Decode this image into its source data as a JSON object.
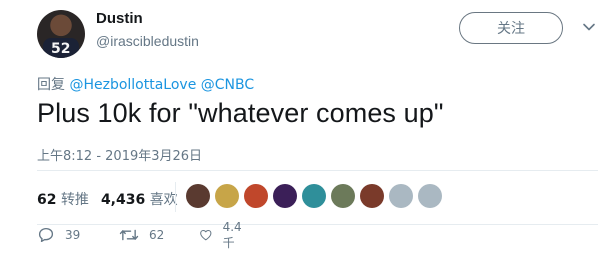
{
  "author": {
    "name": "Dustin",
    "handle": "@irascibledustin",
    "jersey_number": "52"
  },
  "follow_button": {
    "label": "关注"
  },
  "reply_to": {
    "prefix": "回复",
    "mentions": [
      "@HezbollottaLove",
      "@CNBC"
    ]
  },
  "tweet": {
    "text": "Plus 10k for \"whatever comes up\"",
    "timestamp": "上午8:12 - 2019年3月26日"
  },
  "stats": {
    "retweets_count": "62",
    "retweets_label": "转推",
    "likes_count": "4,436",
    "likes_label": "喜欢"
  },
  "liker_avatars": [
    {
      "name": "liker-avatar-1",
      "color": "#5a3a30"
    },
    {
      "name": "liker-avatar-2",
      "color": "#c7a548"
    },
    {
      "name": "liker-avatar-3",
      "color": "#c0472b"
    },
    {
      "name": "liker-avatar-4",
      "color": "#3b1f58"
    },
    {
      "name": "liker-avatar-5",
      "color": "#2f8f9a"
    },
    {
      "name": "liker-avatar-6",
      "color": "#6c7a5a"
    },
    {
      "name": "liker-avatar-7",
      "color": "#7a3a2a"
    },
    {
      "name": "liker-avatar-8",
      "color": "#aab8c2"
    },
    {
      "name": "liker-avatar-9",
      "color": "#aab8c2"
    }
  ],
  "actions": {
    "reply_count": "39",
    "retweet_count": "62",
    "like_count": "4.4千"
  },
  "colors": {
    "link": "#1b95e0",
    "secondary_text": "#657786",
    "primary_text": "#14171a"
  }
}
